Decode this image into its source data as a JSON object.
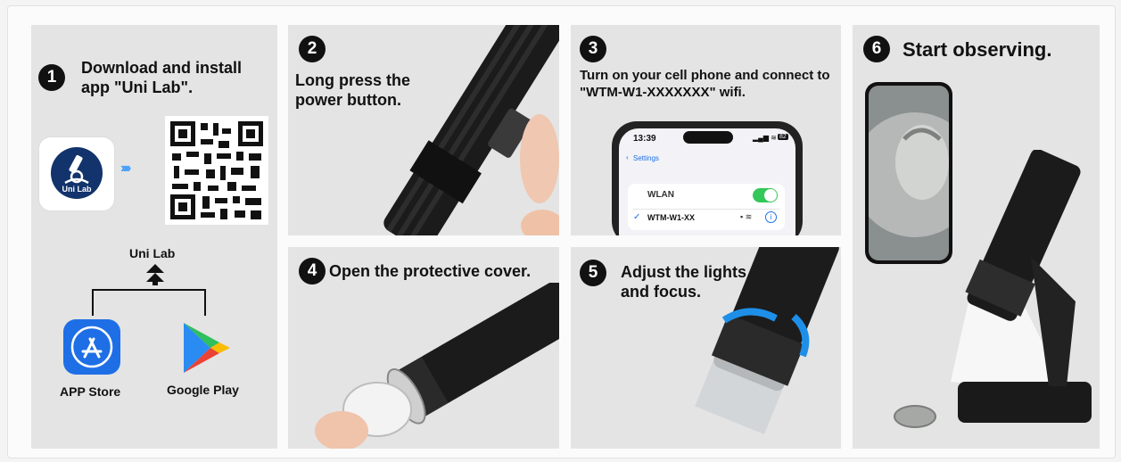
{
  "steps": [
    {
      "number": "1",
      "text": "Download and install app \"Uni Lab\"."
    },
    {
      "number": "2",
      "text": "Long press the power button."
    },
    {
      "number": "3",
      "text": "Turn on your cell phone and connect to \"WTM-W1-XXXXXXX\" wifi."
    },
    {
      "number": "4",
      "text": "Open the protective cover."
    },
    {
      "number": "5",
      "text": "Adjust the lights and focus."
    },
    {
      "number": "6",
      "text": "Start observing."
    }
  ],
  "app": {
    "name": "Uni Lab",
    "icon_label": "Uni Lab",
    "tree_label": "Uni Lab",
    "stores": [
      {
        "name": "APP Store"
      },
      {
        "name": "Google Play"
      }
    ]
  },
  "phone_screen": {
    "time": "13:39",
    "battery": "82",
    "back_label": "Settings",
    "wlan_label": "WLAN",
    "network_name": "WTM-W1-XX"
  },
  "colors": {
    "accent_blue": "#1e6fe6",
    "toggle_green": "#34c759",
    "badge_blue": "#12336b"
  }
}
